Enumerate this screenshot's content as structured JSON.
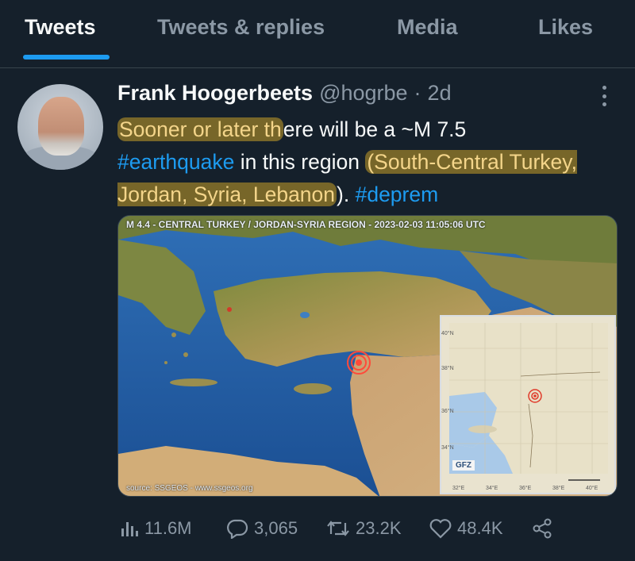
{
  "tabs": [
    {
      "label": "Tweets",
      "active": true
    },
    {
      "label": "Tweets & replies",
      "active": false
    },
    {
      "label": "Media",
      "active": false
    },
    {
      "label": "Likes",
      "active": false
    }
  ],
  "tweet": {
    "author_name": "Frank Hoogerbeets",
    "handle": "@hogrbe",
    "separator": "·",
    "time": "2d",
    "text": {
      "part1_hl": "Sooner or later th",
      "part2": "ere will be a ~M 7.5",
      "hashtag1": "#earthquake",
      "part3": " in this region ",
      "part4_hl": "(South-Central Turkey, Jordan, Syria, Lebanon",
      "part5": "). ",
      "hashtag2": "#deprem"
    },
    "media": {
      "map_title": "M 4.4 - CENTRAL TURKEY / JORDAN-SYRIA REGION - 2023-02-03 11:05:06 UTC",
      "source": "source: SSGEOS - www.ssgeos.org",
      "inset_logo": "GFZ",
      "inset_lat_labels": [
        "40°N",
        "38°N",
        "36°N",
        "34°N"
      ],
      "inset_lon_labels": [
        "32°E",
        "34°E",
        "36°E",
        "38°E",
        "40°E"
      ]
    },
    "stats": {
      "views": "11.6M",
      "replies": "3,065",
      "retweets": "23.2K",
      "likes": "48.4K"
    }
  },
  "icons": [
    "more-icon",
    "views-icon",
    "reply-icon",
    "retweet-icon",
    "like-icon",
    "share-icon"
  ],
  "colors": {
    "background": "#15202b",
    "accent": "#1d9bf0",
    "muted": "#8b98a5",
    "highlight": "#c8a028"
  }
}
